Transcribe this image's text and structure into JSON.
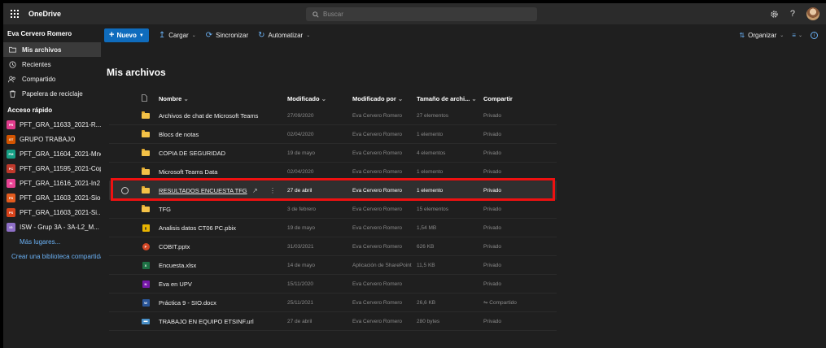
{
  "app": {
    "title": "OneDrive"
  },
  "search": {
    "placeholder": "Buscar"
  },
  "sidebar": {
    "user": "Eva Cervero Romero",
    "nav": [
      {
        "label": "Mis archivos",
        "icon": "folder-icon"
      },
      {
        "label": "Recientes",
        "icon": "clock-icon"
      },
      {
        "label": "Compartido",
        "icon": "people-icon"
      },
      {
        "label": "Papelera de reciclaje",
        "icon": "trash-icon"
      }
    ],
    "quick_access_label": "Acceso rápido",
    "quick_access": [
      {
        "label": "PFT_GRA_11633_2021-R...",
        "color": "#e03c8c",
        "abbr": "PR"
      },
      {
        "label": "GRUPO TRABAJO",
        "color": "#d35400",
        "abbr": "GT"
      },
      {
        "label": "PFT_GRA_11604_2021-Mne",
        "color": "#16a085",
        "abbr": "PM"
      },
      {
        "label": "PFT_GRA_11595_2021-Cop",
        "color": "#c0392b",
        "abbr": "PC"
      },
      {
        "label": "PFT_GRA_11616_2021-In2",
        "color": "#e84393",
        "abbr": "PI"
      },
      {
        "label": "PFT_GRA_11603_2021-Sio",
        "color": "#e35b1e",
        "abbr": "PS"
      },
      {
        "label": "PFT_GRA_11603_2021-Si...",
        "color": "#d8431b",
        "abbr": "PS"
      },
      {
        "label": "ISW - Grup 3A - 3A-L2_M...",
        "color": "#8e6fc7",
        "abbr": "IG"
      }
    ],
    "more_places": "Más lugares...",
    "create_library": "Crear una biblioteca compartida"
  },
  "commands": {
    "new": "Nuevo",
    "upload": "Cargar",
    "sync": "Sincronizar",
    "automate": "Automatizar",
    "sort": "Organizar"
  },
  "main": {
    "title": "Mis archivos",
    "columns": {
      "name": "Nombre",
      "modified": "Modificado",
      "modified_by": "Modificado por",
      "size": "Tamaño de archi...",
      "sharing": "Compartir"
    },
    "rows": [
      {
        "type": "folder",
        "name": "Archivos de chat de Microsoft Teams",
        "modified": "27/09/2020",
        "by": "Eva Cervero Romero",
        "size": "27 elementos",
        "share": "Privado"
      },
      {
        "type": "folder",
        "name": "Blocs de notas",
        "modified": "02/04/2020",
        "by": "Eva Cervero Romero",
        "size": "1 elemento",
        "share": "Privado"
      },
      {
        "type": "folder",
        "name": "COPIA DE SEGURIDAD",
        "modified": "19 de mayo",
        "by": "Eva Cervero Romero",
        "size": "4 elementos",
        "share": "Privado"
      },
      {
        "type": "folder",
        "name": "Microsoft Teams Data",
        "modified": "02/04/2020",
        "by": "Eva Cervero Romero",
        "size": "1 elemento",
        "share": "Privado"
      },
      {
        "type": "folder",
        "name": "RESULTADOS ENCUESTA TFG",
        "modified": "27 de abril",
        "by": "Eva Cervero Romero",
        "size": "1 elemento",
        "share": "Privado",
        "selected": true
      },
      {
        "type": "folder",
        "name": "TFG",
        "modified": "3 de febrero",
        "by": "Eva Cervero Romero",
        "size": "15 elementos",
        "share": "Privado"
      },
      {
        "type": "pbix",
        "name": "Analisis datos CT06 PC.pbix",
        "modified": "19 de mayo",
        "by": "Eva Cervero Romero",
        "size": "1,54 MB",
        "share": "Privado"
      },
      {
        "type": "pptx",
        "name": "COBIT.pptx",
        "modified": "31/03/2021",
        "by": "Eva Cervero Romero",
        "size": "626 KB",
        "share": "Privado"
      },
      {
        "type": "xlsx",
        "name": "Encuesta.xlsx",
        "modified": "14 de mayo",
        "by": "Aplicación de SharePoint",
        "size": "11,5 KB",
        "share": "Privado"
      },
      {
        "type": "onenote",
        "name": "Eva en UPV",
        "modified": "15/11/2020",
        "by": "Eva Cervero Romero",
        "size": "",
        "share": "Privado"
      },
      {
        "type": "docx",
        "name": "Práctica 9 - SIO.docx",
        "modified": "25/11/2021",
        "by": "Eva Cervero Romero",
        "size": "26,6 KB",
        "share": "Compartido"
      },
      {
        "type": "url",
        "name": "TRABAJO EN EQUIPO ETSINF.url",
        "modified": "27 de abril",
        "by": "Eva Cervero Romero",
        "size": "280 bytes",
        "share": "Privado"
      }
    ]
  },
  "colors": {
    "accent": "#0f6cbd",
    "highlight": "#ee1111",
    "folder": "#f4c247"
  }
}
